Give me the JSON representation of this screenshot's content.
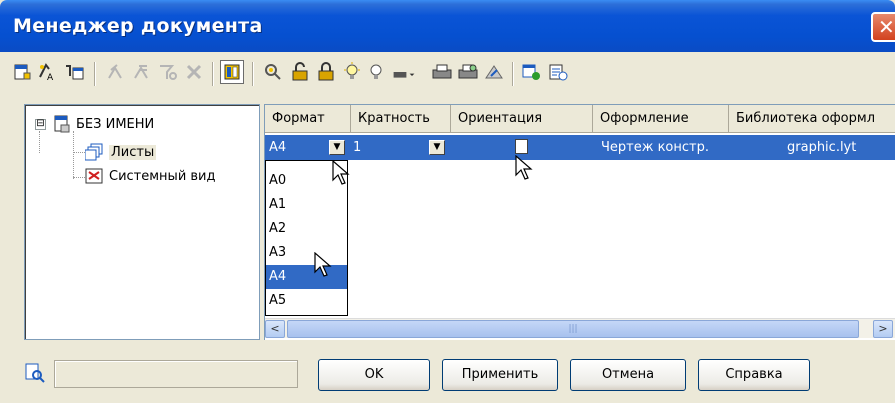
{
  "window": {
    "title": "Менеджер документа",
    "close_glyph": "✕"
  },
  "toolbar": {
    "icons": [
      "new-sheet-icon",
      "new-view-icon",
      "sheet-params-icon",
      "move-up-icon",
      "move-down-icon",
      "filter-icon",
      "delete-icon",
      "grid-view-icon",
      "find-icon",
      "lock-icon",
      "lock-closed-icon",
      "bulb-on-icon",
      "bulb-off-icon",
      "color-icon",
      "print-icon",
      "print-preview-icon",
      "export-icon",
      "layout-icon",
      "settings-icon"
    ]
  },
  "tree": {
    "root_label": "БЕЗ ИМЕНИ",
    "root_expander": "⊟",
    "children": [
      {
        "label": "Листы"
      },
      {
        "label": "Системный вид"
      }
    ]
  },
  "grid": {
    "headers": [
      "Формат",
      "Кратность",
      "Ориентация",
      "Оформление",
      "Библиотека оформл"
    ],
    "row": {
      "format": "A4",
      "multiplicity": "1",
      "design": "Чертеж констр.",
      "library": "graphic.lyt"
    }
  },
  "dropdown": {
    "options": [
      "A0",
      "A1",
      "A2",
      "A3",
      "A4",
      "A5"
    ],
    "selected": "A4"
  },
  "scrollbar": {
    "left_arrow": "<",
    "right_arrow": ">",
    "grip": "|||"
  },
  "buttons": {
    "ok": "OK",
    "apply": "Применить",
    "cancel": "Отмена",
    "help": "Справка"
  },
  "colors": {
    "selection": "#316ac5",
    "titlebar": "#0a54d6",
    "dialog": "#ece9d8"
  }
}
